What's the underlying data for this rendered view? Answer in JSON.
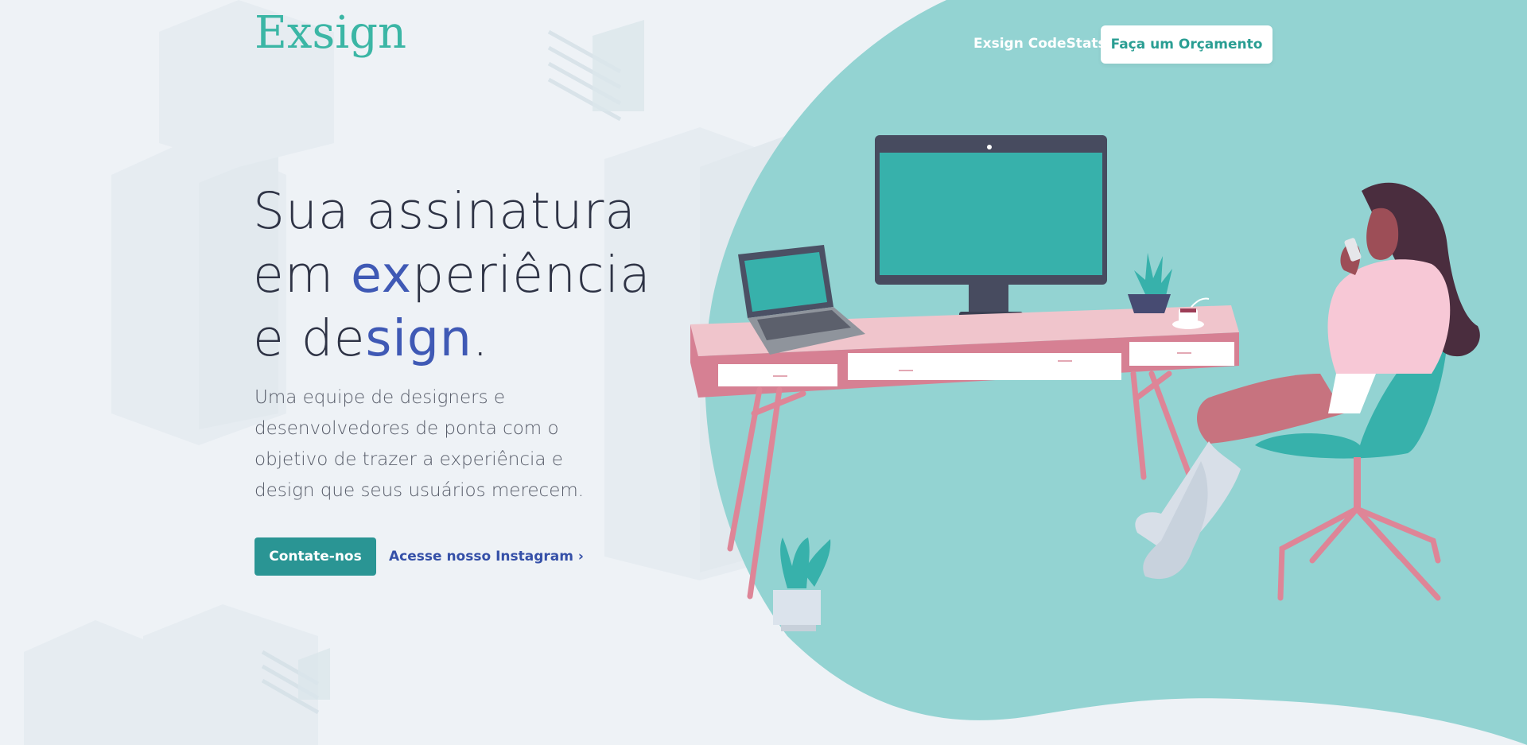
{
  "header": {
    "logo": "Exsign",
    "nav_link": "Exsign CodeStats",
    "quote_button": "Faça um Orçamento"
  },
  "hero": {
    "headline": {
      "line1": "Sua assinatura",
      "line2_prefix": "em ",
      "line2_highlight": "ex",
      "line2_suffix": "periência",
      "line3_prefix": "e de",
      "line3_highlight": "sign",
      "line3_suffix": "."
    },
    "subtitle": "Uma equipe de designers e desenvolvedores de ponta com o objetivo de trazer a experiência e design que seus usuários merecem.",
    "cta_button": "Contate-nos",
    "instagram_link": "Acesse nosso Instagram",
    "instagram_chevron": "›"
  },
  "colors": {
    "accent_teal": "#3bb6a5",
    "button_teal": "#2a9594",
    "blob_teal": "#93d3d2",
    "highlight_blue": "#3f59b5",
    "text_dark": "#2e3345",
    "background": "#eef2f6"
  },
  "icons": {
    "instagram_chevron": "chevron-right-icon"
  }
}
